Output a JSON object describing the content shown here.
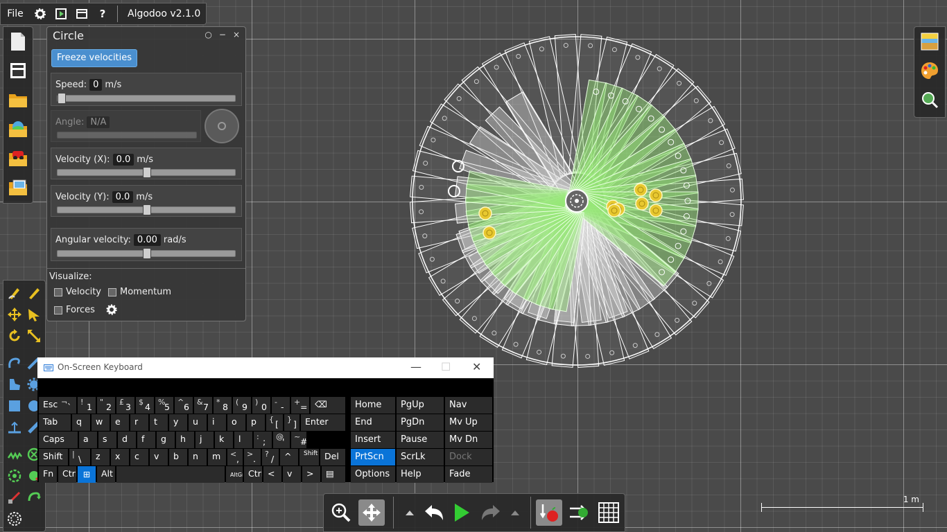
{
  "app": {
    "title": "Algodoo v2.1.0",
    "file_menu": "File"
  },
  "circle_panel": {
    "title": "Circle",
    "freeze_label": "Freeze velocities",
    "speed": {
      "label": "Speed:",
      "value": "0",
      "unit": "m/s",
      "position": 0.0
    },
    "angle": {
      "label": "Angle:",
      "value": "N/A"
    },
    "velocity_x": {
      "label": "Velocity (X):",
      "value": "0.0",
      "unit": "m/s",
      "position": 0.5
    },
    "velocity_y": {
      "label": "Velocity (Y):",
      "value": "0.0",
      "unit": "m/s",
      "position": 0.5
    },
    "angular_velocity": {
      "label": "Angular velocity:",
      "value": "0.00",
      "unit": "rad/s",
      "position": 0.5
    },
    "visualize": {
      "label": "Visualize:",
      "velocity": "Velocity",
      "momentum": "Momentum",
      "forces": "Forces"
    }
  },
  "scale_label": "1 m",
  "osk": {
    "title": "On-Screen Keyboard",
    "rows": [
      [
        {
          "main": "Esc"
        },
        {
          "sup": "¬",
          "main": "`"
        },
        {
          "sup": "!",
          "main": "1"
        },
        {
          "sup": "\"",
          "main": "2"
        },
        {
          "sup": "£",
          "main": "3"
        },
        {
          "sup": "$",
          "main": "4"
        },
        {
          "sup": "%",
          "main": "5"
        },
        {
          "sup": "^",
          "main": "6"
        },
        {
          "sup": "&",
          "main": "7"
        },
        {
          "sup": "*",
          "main": "8"
        },
        {
          "sup": "(",
          "main": "9"
        },
        {
          "sup": ")",
          "main": "0"
        },
        {
          "sup": "-",
          "main": "-"
        },
        {
          "sup": "+",
          "main": "="
        },
        {
          "main": "⌫"
        }
      ],
      [
        {
          "main": "Tab"
        },
        {
          "main": "q"
        },
        {
          "main": "w"
        },
        {
          "main": "e"
        },
        {
          "main": "r"
        },
        {
          "main": "t"
        },
        {
          "main": "y"
        },
        {
          "main": "u"
        },
        {
          "main": "i"
        },
        {
          "main": "o"
        },
        {
          "main": "p"
        },
        {
          "sup": "{",
          "main": "["
        },
        {
          "sup": "}",
          "main": "]"
        },
        {
          "main": "Enter"
        }
      ],
      [
        {
          "main": "Caps"
        },
        {
          "main": "a"
        },
        {
          "main": "s"
        },
        {
          "main": "d"
        },
        {
          "main": "f"
        },
        {
          "main": "g"
        },
        {
          "main": "h"
        },
        {
          "main": "j"
        },
        {
          "main": "k"
        },
        {
          "main": "l"
        },
        {
          "sup": ":",
          "main": ";"
        },
        {
          "sup": "@",
          "main": "'"
        },
        {
          "sup": "~",
          "main": "#"
        }
      ],
      [
        {
          "main": "Shift"
        },
        {
          "sup": "|",
          "main": "\\"
        },
        {
          "main": "z"
        },
        {
          "main": "x"
        },
        {
          "main": "c"
        },
        {
          "main": "v"
        },
        {
          "main": "b"
        },
        {
          "main": "n"
        },
        {
          "main": "m"
        },
        {
          "sup": "<",
          "main": ","
        },
        {
          "sup": ">",
          "main": "."
        },
        {
          "sup": "?",
          "main": "/"
        },
        {
          "main": "^"
        },
        {
          "main": "Shift"
        },
        {
          "main": "Del"
        }
      ],
      [
        {
          "main": "Fn"
        },
        {
          "main": "Ctrl"
        },
        {
          "main": "⊞"
        },
        {
          "main": "Alt"
        },
        {
          "main": ""
        },
        {
          "main": "AltGr"
        },
        {
          "main": "Ctrl"
        },
        {
          "main": "<"
        },
        {
          "main": "v"
        },
        {
          "main": ">"
        },
        {
          "main": "▤"
        }
      ]
    ],
    "nav": [
      [
        "Home",
        "PgUp",
        "Nav"
      ],
      [
        "End",
        "PgDn",
        "Mv Up"
      ],
      [
        "Insert",
        "Pause",
        "Mv Dn"
      ],
      [
        "PrtScn",
        "ScrLk",
        "Dock"
      ],
      [
        "Options",
        "Help",
        "Fade"
      ]
    ]
  },
  "icons": {
    "top": [
      "gear-icon",
      "play-scene-icon",
      "window-icon",
      "help-icon"
    ],
    "left_top": [
      "new-scene-icon",
      "toolbar-toggle-icon",
      "open-folder-icon",
      "open-scene-icon",
      "phunlet-icon",
      "browse-icon"
    ],
    "right": [
      "background-icon",
      "appearance-icon",
      "zoom-fit-icon"
    ],
    "bottom": [
      "zoom-icon",
      "move-icon",
      "up-arrow-icon",
      "undo-icon",
      "play-icon",
      "redo-icon",
      "down-arrow-icon",
      "gravity-icon",
      "air-icon",
      "grid-icon"
    ]
  }
}
